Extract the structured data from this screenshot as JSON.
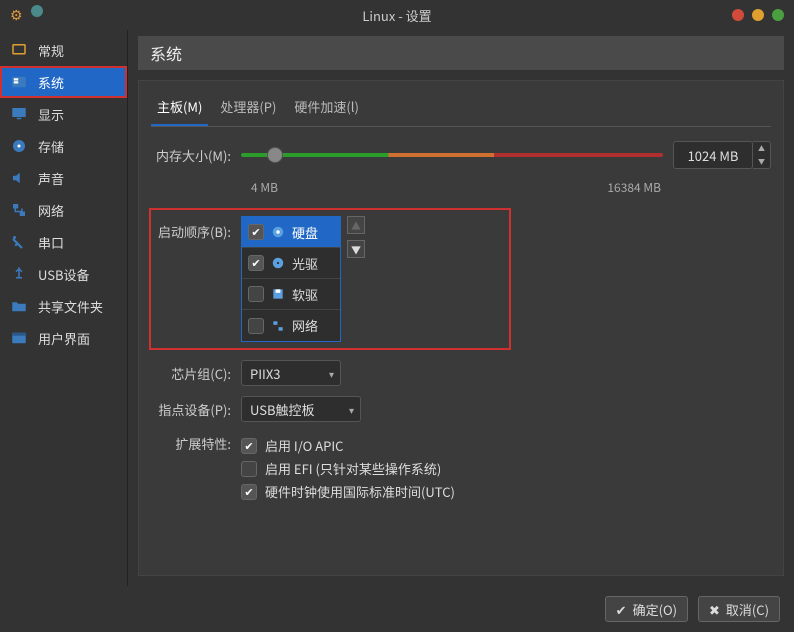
{
  "window": {
    "title": "Linux - 设置"
  },
  "titlebar_colors": {
    "gear": "#e09a3e",
    "dot_left": "#4a8a8a",
    "close": "#d14a3a",
    "min": "#e0a030",
    "max": "#4aa040"
  },
  "sidebar": [
    {
      "id": "general",
      "label": "常规",
      "icon": "general"
    },
    {
      "id": "system",
      "label": "系统",
      "icon": "system",
      "active": true,
      "highlighted": true
    },
    {
      "id": "display",
      "label": "显示",
      "icon": "display"
    },
    {
      "id": "storage",
      "label": "存储",
      "icon": "storage"
    },
    {
      "id": "audio",
      "label": "声音",
      "icon": "audio"
    },
    {
      "id": "network",
      "label": "网络",
      "icon": "network"
    },
    {
      "id": "serial",
      "label": "串口",
      "icon": "serial"
    },
    {
      "id": "usb",
      "label": "USB设备",
      "icon": "usb"
    },
    {
      "id": "shared",
      "label": "共享文件夹",
      "icon": "shared"
    },
    {
      "id": "ui",
      "label": "用户界面",
      "icon": "ui"
    }
  ],
  "content": {
    "header": "系统",
    "tabs": [
      {
        "id": "motherboard",
        "label": "主板(M)",
        "active": true
      },
      {
        "id": "processor",
        "label": "处理器(P)"
      },
      {
        "id": "accel",
        "label": "硬件加速(l)"
      }
    ],
    "memory": {
      "label": "内存大小(M):",
      "value": "1024 MB",
      "min_label": "4 MB",
      "max_label": "16384 MB",
      "thumb_pct": 8
    },
    "boot": {
      "label": "启动顺序(B):",
      "items": [
        {
          "label": "硬盘",
          "checked": true,
          "selected": true,
          "icon": "hdd"
        },
        {
          "label": "光驱",
          "checked": true,
          "icon": "cd"
        },
        {
          "label": "软驱",
          "checked": false,
          "icon": "floppy"
        },
        {
          "label": "网络",
          "checked": false,
          "icon": "net"
        }
      ]
    },
    "chipset": {
      "label": "芯片组(C):",
      "value": "PIIX3"
    },
    "pointing": {
      "label": "指点设备(P):",
      "value": "USB触控板"
    },
    "extended": {
      "label": "扩展特性:",
      "items": [
        {
          "label": "启用 I/O APIC",
          "checked": true
        },
        {
          "label": "启用 EFI (只针对某些操作系统)",
          "checked": false
        },
        {
          "label": "硬件时钟使用国际标准时间(UTC)",
          "checked": true
        }
      ]
    }
  },
  "buttons": {
    "ok": "确定(O)",
    "cancel": "取消(C)"
  }
}
